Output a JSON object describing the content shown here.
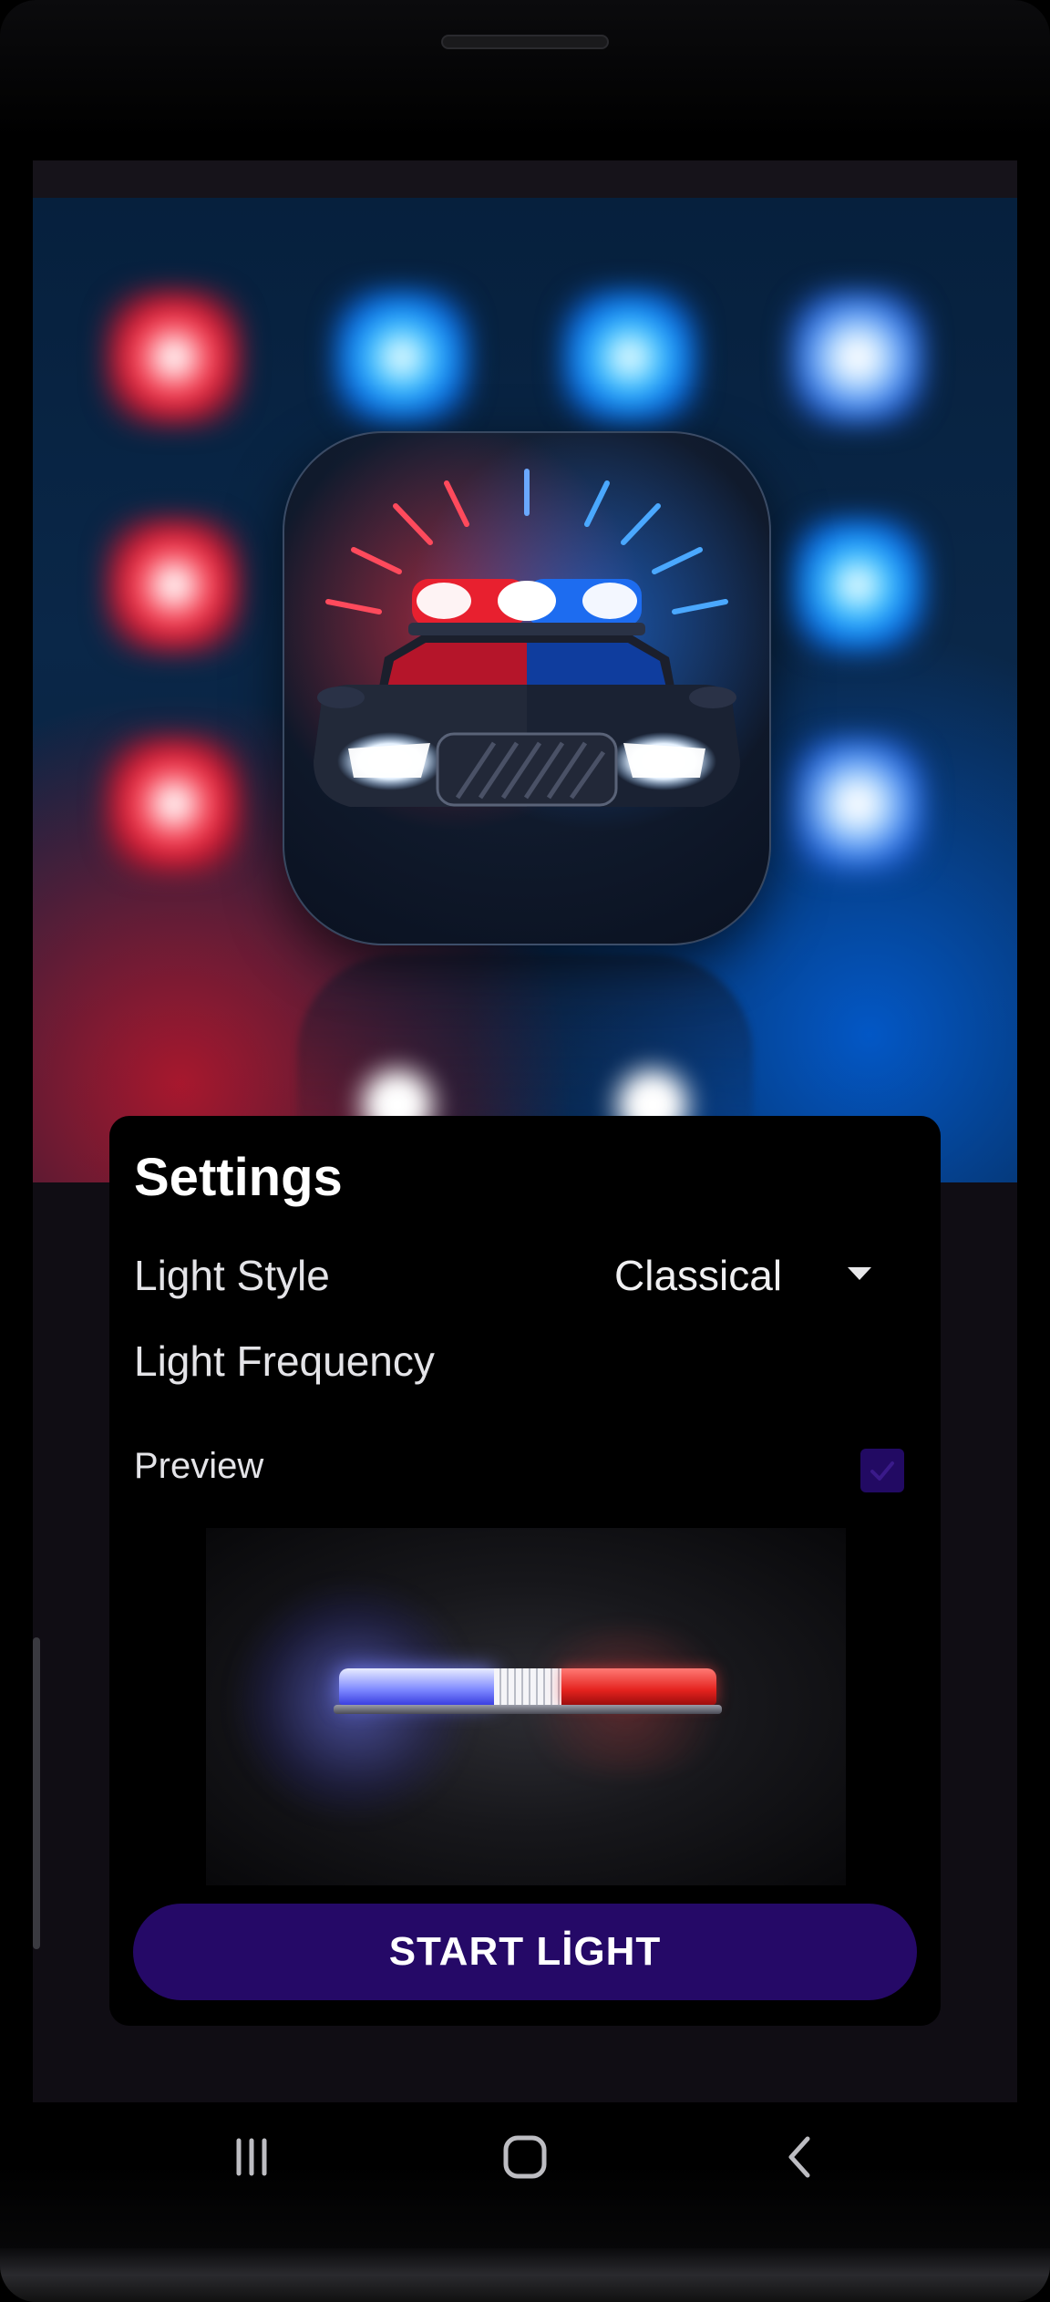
{
  "settings": {
    "title": "Settings",
    "light_style_label": "Light Style",
    "light_style_value": "Classical",
    "light_frequency_label": "Light Frequency",
    "preview_label": "Preview",
    "preview_checked": true
  },
  "start_button_label": "START LİGHT",
  "colors": {
    "accent": "#250967",
    "card_background": "#000000",
    "screen_background": "#100d14"
  },
  "icons": [
    "police-car-app-icon",
    "dropdown-arrow-icon",
    "checkbox-check-icon",
    "recents-icon",
    "home-icon",
    "back-icon"
  ]
}
